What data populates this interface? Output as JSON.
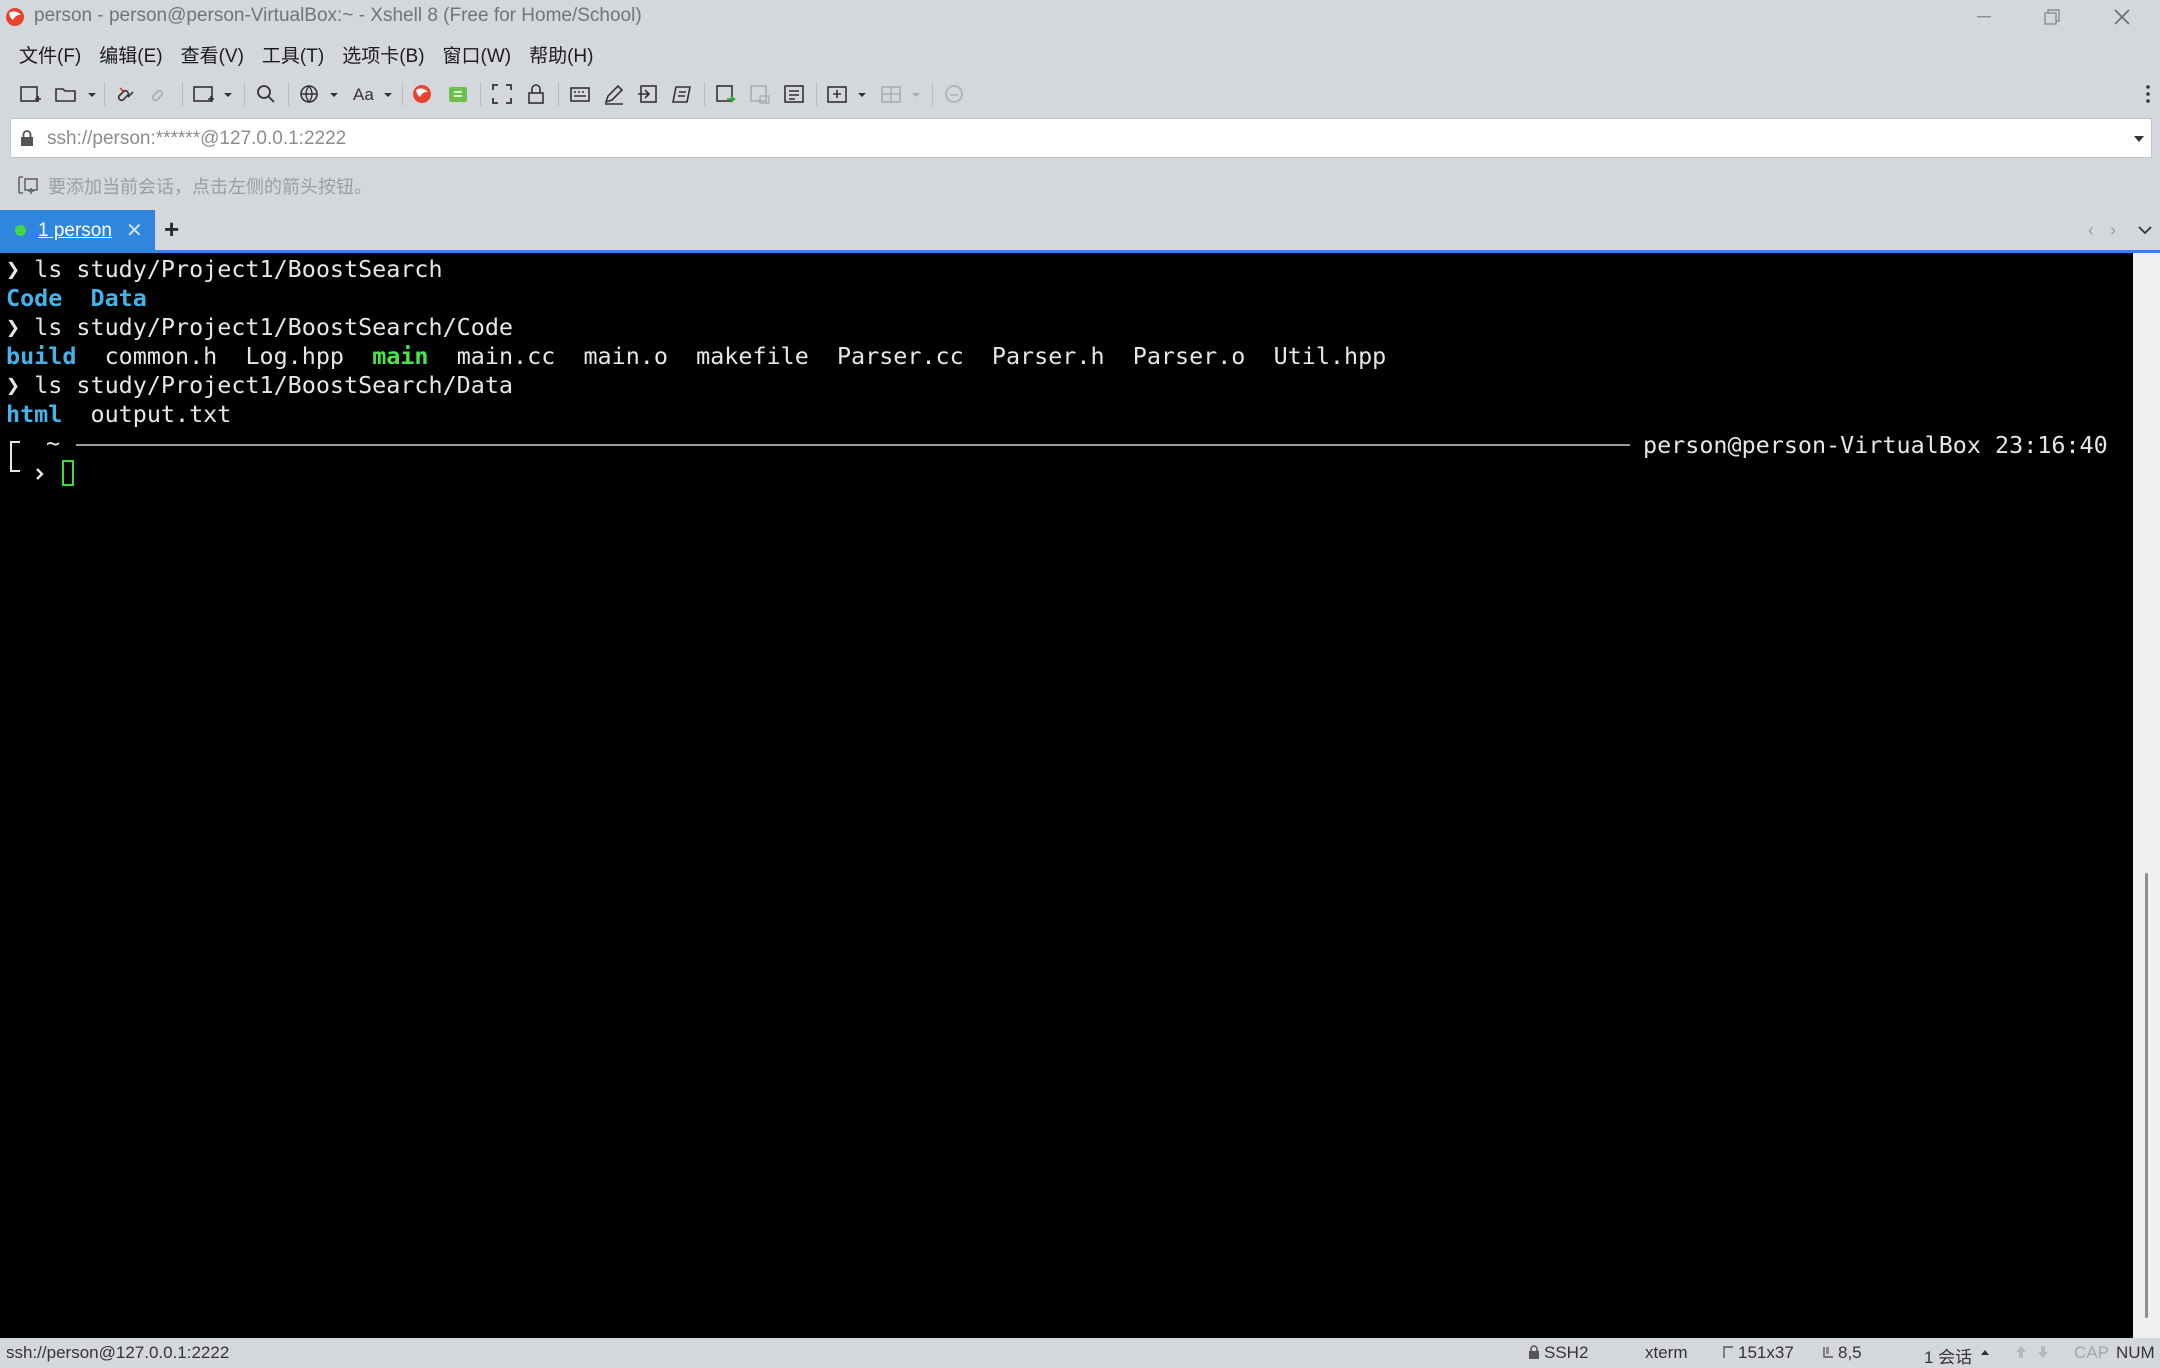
{
  "window": {
    "title": "person - person@person-VirtualBox:~ - Xshell 8 (Free for Home/School)",
    "controls": {
      "minimize": "—",
      "restore": "❐",
      "close": "✕"
    }
  },
  "menu": [
    "文件(F)",
    "编辑(E)",
    "查看(V)",
    "工具(T)",
    "选项卡(B)",
    "窗口(W)",
    "帮助(H)"
  ],
  "address_bar": {
    "value": "ssh://person:******@127.0.0.1:2222"
  },
  "hint_bar": {
    "text": "要添加当前会话，点击左侧的箭头按钮。"
  },
  "tabs": [
    {
      "label": "1 person",
      "active": true,
      "status_color": "#41d843"
    }
  ],
  "terminal": {
    "prompt_symbol": "❯",
    "lines": [
      {
        "cmd": "ls study/Project1/BoostSearch"
      },
      {
        "items": [
          {
            "t": "Code",
            "k": "dir"
          },
          {
            "t": "Data",
            "k": "dir"
          }
        ]
      },
      {
        "cmd": "ls study/Project1/BoostSearch/Code"
      },
      {
        "items": [
          {
            "t": "build",
            "k": "dir"
          },
          {
            "t": "common.h",
            "k": "file"
          },
          {
            "t": "Log.hpp",
            "k": "file"
          },
          {
            "t": "main",
            "k": "exe"
          },
          {
            "t": "main.cc",
            "k": "file"
          },
          {
            "t": "main.o",
            "k": "file"
          },
          {
            "t": "makefile",
            "k": "file"
          },
          {
            "t": "Parser.cc",
            "k": "file"
          },
          {
            "t": "Parser.h",
            "k": "file"
          },
          {
            "t": "Parser.o",
            "k": "file"
          },
          {
            "t": "Util.hpp",
            "k": "file"
          }
        ]
      },
      {
        "cmd": "ls study/Project1/BoostSearch/Data"
      },
      {
        "items": [
          {
            "t": "html",
            "k": "dir"
          },
          {
            "t": "output.txt",
            "k": "file"
          }
        ]
      }
    ],
    "prompt_dir": "~",
    "prompt_right": "person@person-VirtualBox 23:16:40",
    "colors": {
      "dir": "#43b3ea",
      "exe": "#48e64a",
      "text": "#e6e6e6",
      "cursor": "#3ddc3d"
    }
  },
  "status_bar": {
    "connection": "ssh://person@127.0.0.1:2222",
    "protocol": "SSH2",
    "terminal_type": "xterm",
    "size": "151x37",
    "cursor_pos": "8,5",
    "sessions": "1 会话",
    "cap": "CAP",
    "num": "NUM"
  }
}
